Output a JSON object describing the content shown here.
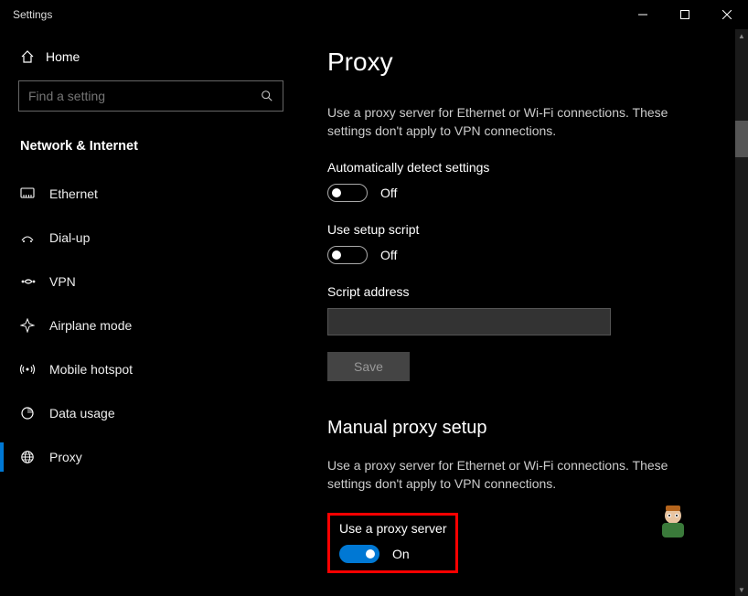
{
  "window": {
    "title": "Settings"
  },
  "sidebar": {
    "home": "Home",
    "search_placeholder": "Find a setting",
    "heading": "Network & Internet",
    "items": [
      {
        "label": "Ethernet"
      },
      {
        "label": "Dial-up"
      },
      {
        "label": "VPN"
      },
      {
        "label": "Airplane mode"
      },
      {
        "label": "Mobile hotspot"
      },
      {
        "label": "Data usage"
      },
      {
        "label": "Proxy"
      }
    ]
  },
  "page": {
    "title": "Proxy",
    "auto_desc": "Use a proxy server for Ethernet or Wi-Fi connections. These settings don't apply to VPN connections.",
    "auto_detect_label": "Automatically detect settings",
    "auto_detect_state": "Off",
    "setup_script_label": "Use setup script",
    "setup_script_state": "Off",
    "script_address_label": "Script address",
    "save_label": "Save",
    "manual_heading": "Manual proxy setup",
    "manual_desc": "Use a proxy server for Ethernet or Wi-Fi connections. These settings don't apply to VPN connections.",
    "use_proxy_label": "Use a proxy server",
    "use_proxy_state": "On"
  }
}
